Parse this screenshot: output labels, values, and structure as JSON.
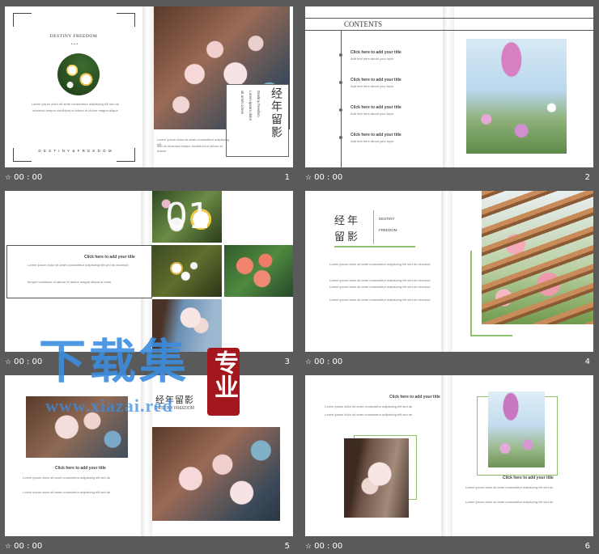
{
  "thumbs": [
    {
      "time": "00 : 00",
      "num": "1"
    },
    {
      "time": "00 : 00",
      "num": "2"
    },
    {
      "time": "00 : 00",
      "num": "3"
    },
    {
      "time": "00 : 00",
      "num": "4"
    },
    {
      "time": "00 : 00",
      "num": "5"
    },
    {
      "time": "00 : 00",
      "num": "6"
    }
  ],
  "s1": {
    "title": "DESTINY FREEDOM",
    "bottom": "D E S T I N Y & F R E E D O M",
    "body1": "Lorem ipsum dolor sit amet consectetur adipiscing elit sed do",
    "body2": "eiusmod tempor incididunt ut labore et dolore magna aliqua",
    "vtitle": "经年留影",
    "vsub1": "Destiny freedom",
    "vsub2": "Lorem ipsum dolor",
    "vsub3": "sit amet conse",
    "cap1": "Lorem ipsum dolor sit amet consectetur adipiscing elit",
    "cap2": "sed do eiusmod tempor incididunt ut labore et dolore"
  },
  "s2": {
    "contents": "CONTENTS",
    "items": [
      {
        "title": "Click here to add your title",
        "text": "Add text here about your topic"
      },
      {
        "title": "Click here to add your title",
        "text": "Add text here about your topic"
      },
      {
        "title": "Click here to add your title",
        "text": "Add text here about your topic"
      },
      {
        "title": "Click here to add your title",
        "text": "Add text here about your topic"
      }
    ]
  },
  "s3": {
    "big": "01",
    "title": "Click here to add your title",
    "p1": "Lorem ipsum dolor sit amet consectetur adipiscing elit sed do eiusmod",
    "p2": "tempor incididunt ut labore et dolore magna aliqua ut enim"
  },
  "s4": {
    "cn1": "经年",
    "cn2": "留影",
    "en1": "DESTINY",
    "en2": "FREEDOM",
    "lines": [
      "Lorem ipsum dolor sit amet consectetur adipiscing elit sed do eiusmod",
      "Lorem ipsum dolor sit amet consectetur adipiscing elit sed do eiusmod",
      "Lorem ipsum dolor sit amet consectetur adipiscing elit sed do eiusmod",
      "Lorem ipsum dolor sit amet consectetur adipiscing elit sed do eiusmod"
    ]
  },
  "s5": {
    "cn": "经年留影",
    "en": "DESTINY FREEDOM",
    "title": "Click here to add your title",
    "p1": "Lorem ipsum dolor sit amet consectetur adipiscing elit sed do",
    "p2": "Lorem ipsum dolor sit amet consectetur adipiscing elit sed do"
  },
  "s6": {
    "title1": "Click here to add your title",
    "p1": "Lorem ipsum dolor sit amet consectetur adipiscing elit sed do",
    "p2": "Lorem ipsum dolor sit amet consectetur adipiscing elit sed do",
    "title2": "Click here to add your title",
    "p3": "Lorem ipsum dolor sit amet consectetur adipiscing elit sed do",
    "p4": "Lorem ipsum dolor sit amet consectetur adipiscing elit sed do"
  },
  "watermark": {
    "cn": "下载集",
    "stamp": "专业",
    "url": "www.xiazai.red"
  }
}
